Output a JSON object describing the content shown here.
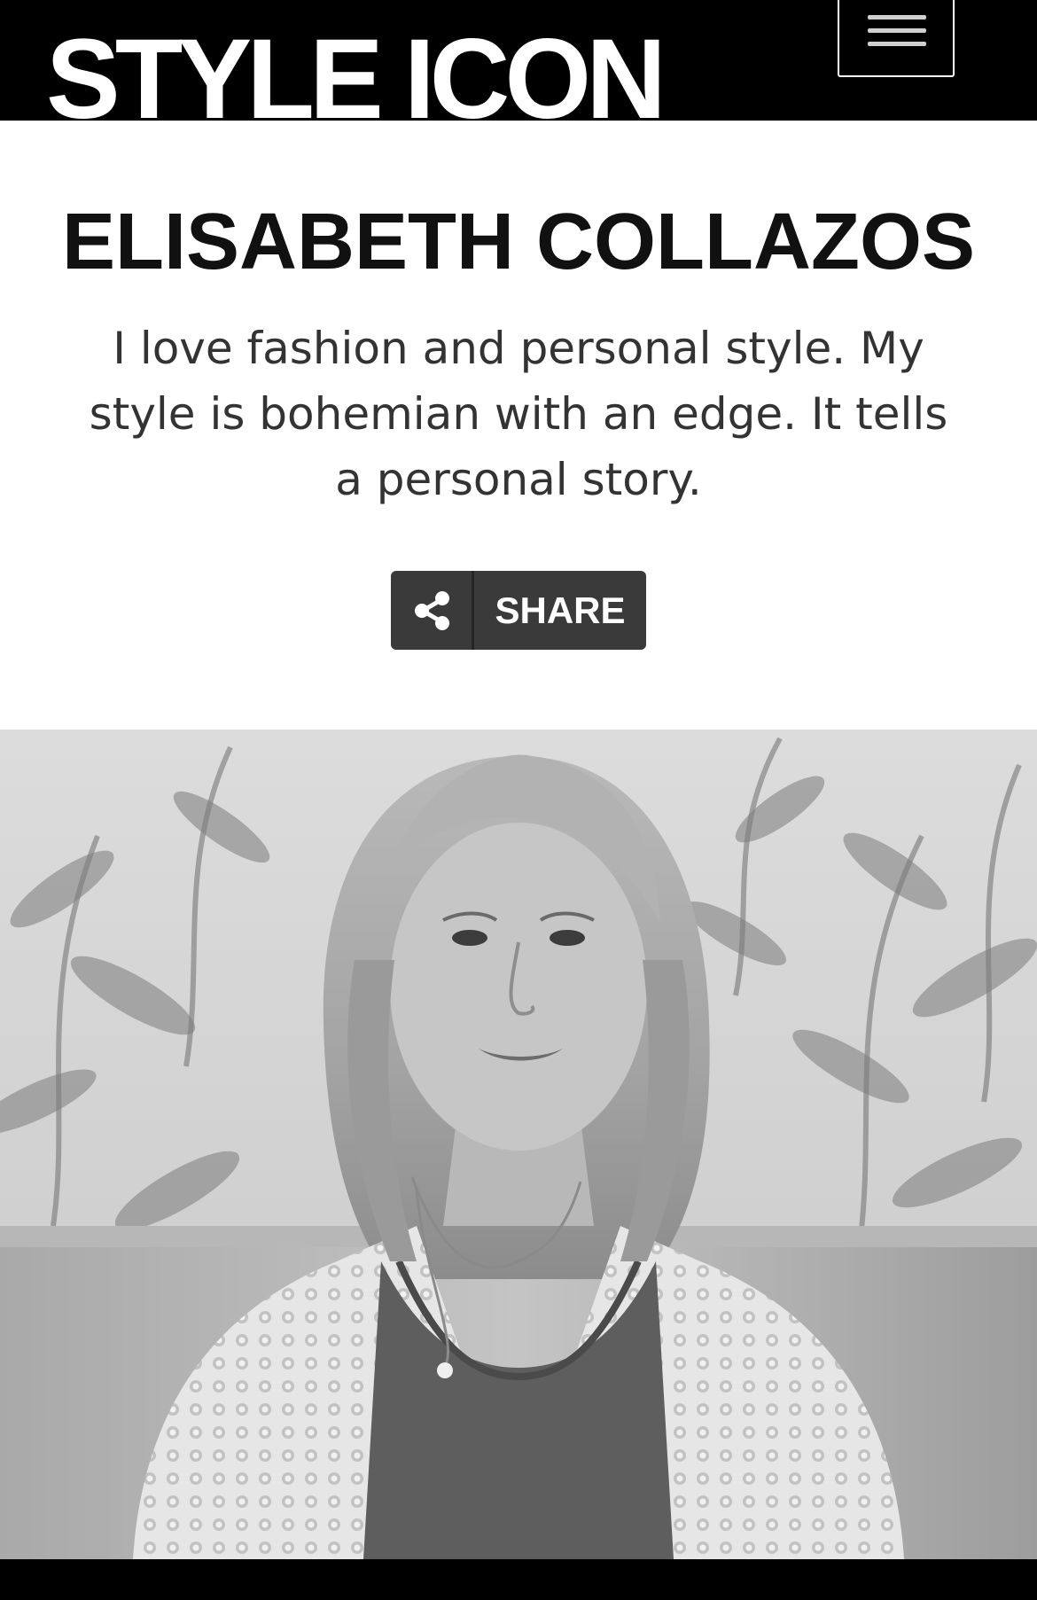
{
  "header": {
    "logo_text": "STYLE ICON",
    "menu_icon": "hamburger-menu-icon"
  },
  "profile": {
    "name": "ELISABETH COLLAZOS",
    "intro": "I love fashion and personal style. My style is bohemian with an edge. It tells a personal story."
  },
  "share": {
    "label": "SHARE",
    "icon": "share-icon"
  },
  "photo": {
    "subject": "portrait-photo",
    "tone": "black-and-white"
  },
  "colors": {
    "header_bg": "#000000",
    "title_text": "#111111",
    "body_text": "#333333",
    "share_bg": "#3a3a3a"
  }
}
